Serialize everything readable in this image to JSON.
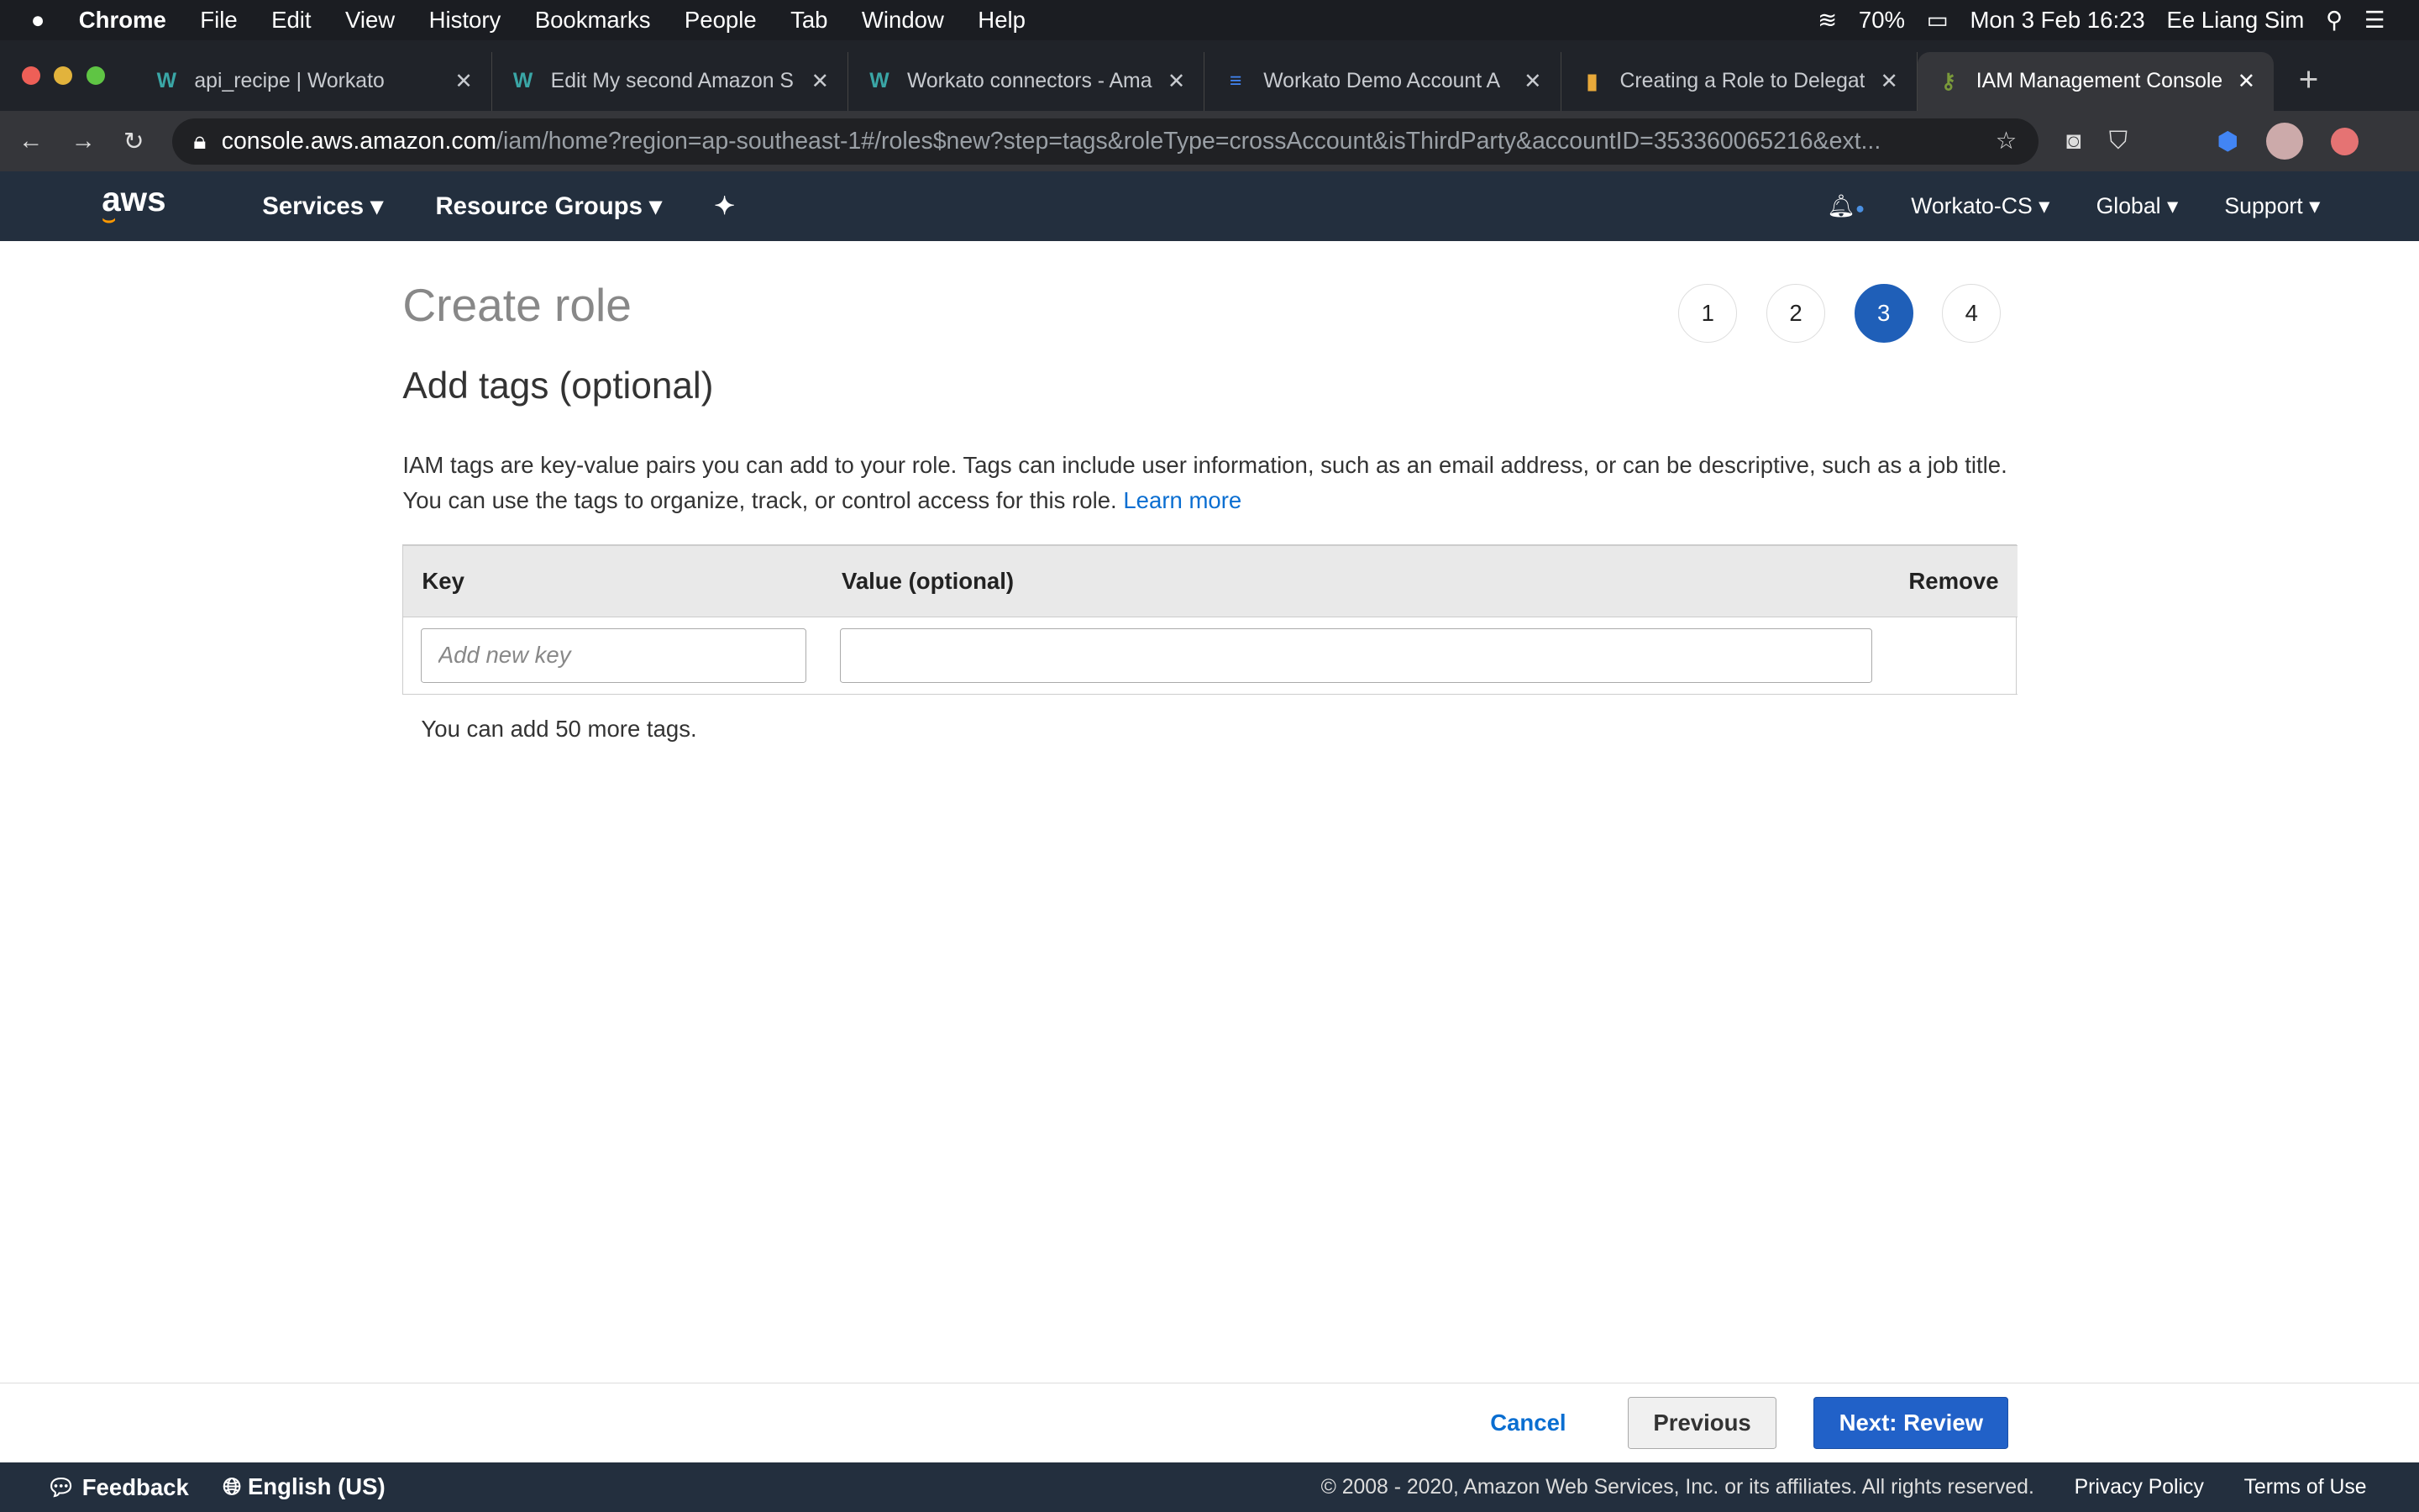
{
  "menubar": {
    "apple": "",
    "app": "Chrome",
    "items": [
      "File",
      "Edit",
      "View",
      "History",
      "Bookmarks",
      "People",
      "Tab",
      "Window",
      "Help"
    ],
    "battery": "70%",
    "datetime": "Mon 3 Feb  16:23",
    "user": "Ee Liang Sim"
  },
  "tabs": [
    {
      "icon": "W",
      "title": "api_recipe | Workato"
    },
    {
      "icon": "W",
      "title": "Edit My second Amazon S"
    },
    {
      "icon": "W",
      "title": "Workato connectors - Ama"
    },
    {
      "icon": "≡",
      "title": "Workato Demo Account A"
    },
    {
      "icon": "▮",
      "title": "Creating a Role to Delegat"
    },
    {
      "icon": "⚷",
      "title": "IAM Management Console"
    }
  ],
  "url": {
    "host": "console.aws.amazon.com",
    "path": "/iam/home?region=ap-southeast-1#/roles$new?step=tags&roleType=crossAccount&isThirdParty&accountID=353360065216&ext..."
  },
  "aws": {
    "logo": "aws",
    "services": "Services",
    "resource_groups": "Resource Groups",
    "account": "Workato-CS",
    "region": "Global",
    "support": "Support"
  },
  "page": {
    "title": "Create role",
    "subtitle": "Add tags (optional)",
    "steps": [
      "1",
      "2",
      "3",
      "4"
    ],
    "active_step": 3,
    "description": "IAM tags are key-value pairs you can add to your role. Tags can include user information, such as an email address, or can be descriptive, such as a job title. You can use the tags to organize, track, or control access for this role. ",
    "learn_more": "Learn more",
    "table": {
      "headers": [
        "Key",
        "Value (optional)",
        "Remove"
      ],
      "key_placeholder": "Add new key",
      "value": ""
    },
    "more_tags": "You can add 50 more tags."
  },
  "footer": {
    "cancel": "Cancel",
    "previous": "Previous",
    "next": "Next: Review"
  },
  "bottom": {
    "feedback": "Feedback",
    "language": "English (US)",
    "copyright": "© 2008 - 2020, Amazon Web Services, Inc. or its affiliates. All rights reserved.",
    "privacy": "Privacy Policy",
    "terms": "Terms of Use"
  }
}
